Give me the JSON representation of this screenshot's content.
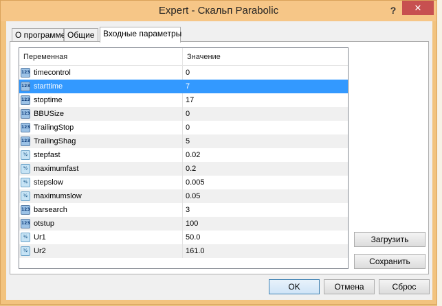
{
  "window": {
    "title": "Expert - Скальп Parabolic",
    "help_label": "?",
    "close_label": "✕"
  },
  "tabs": [
    {
      "label": "О программе",
      "active": false
    },
    {
      "label": "Общие",
      "active": false
    },
    {
      "label": "Входные параметры",
      "active": true
    }
  ],
  "grid": {
    "columns": [
      "Переменная",
      "Значение"
    ],
    "rows": [
      {
        "icon": "integer-type-icon",
        "name": "timecontrol",
        "value": "0"
      },
      {
        "icon": "integer-type-icon",
        "name": "starttime",
        "value": "7",
        "selected": true
      },
      {
        "icon": "integer-type-icon",
        "name": "stoptime",
        "value": "17"
      },
      {
        "icon": "integer-type-icon",
        "name": "BBUSize",
        "value": "0"
      },
      {
        "icon": "integer-type-icon",
        "name": "TrailingStop",
        "value": "0"
      },
      {
        "icon": "integer-type-icon",
        "name": "TrailingShag",
        "value": "5"
      },
      {
        "icon": "double-type-icon",
        "name": "stepfast",
        "value": "0.02"
      },
      {
        "icon": "double-type-icon",
        "name": "maximumfast",
        "value": "0.2"
      },
      {
        "icon": "double-type-icon",
        "name": "stepslow",
        "value": "0.005"
      },
      {
        "icon": "double-type-icon",
        "name": "maximumslow",
        "value": "0.05"
      },
      {
        "icon": "integer-type-icon",
        "name": "barsearch",
        "value": "3"
      },
      {
        "icon": "integer-type-icon",
        "name": "otstup",
        "value": "100"
      },
      {
        "icon": "double-type-icon",
        "name": "Ur1",
        "value": "50.0"
      },
      {
        "icon": "double-type-icon",
        "name": "Ur2",
        "value": "161.0"
      }
    ]
  },
  "side_buttons": {
    "load_label": "Загрузить",
    "save_label": "Сохранить"
  },
  "bottom_buttons": {
    "ok_label": "OK",
    "cancel_label": "Отмена",
    "reset_label": "Сброс"
  },
  "colors": {
    "selection": "#3399ff",
    "close_button": "#c75050",
    "frame": "#f2c37e"
  }
}
